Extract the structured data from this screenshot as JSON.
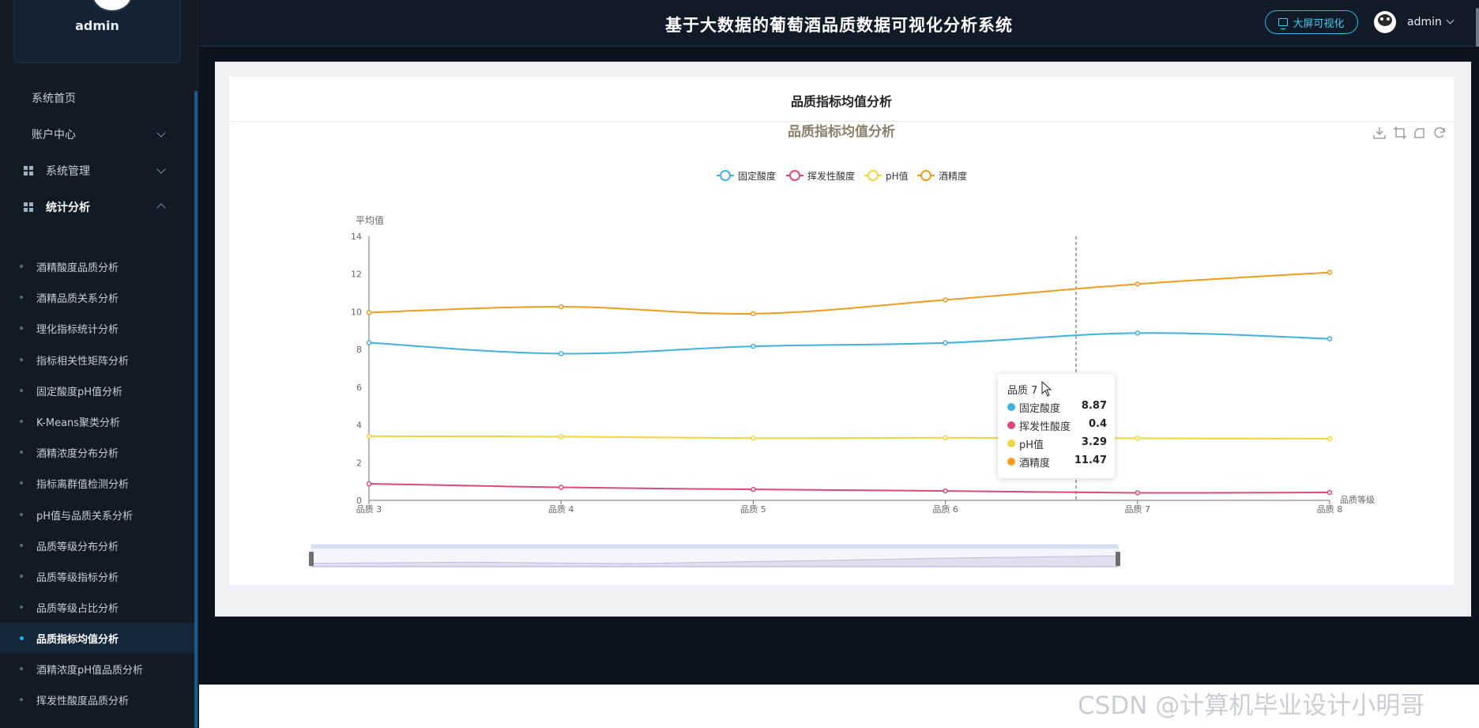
{
  "sidebar": {
    "profile_name": "admin",
    "menu": [
      {
        "label": "系统首页"
      },
      {
        "label": "账户中心"
      },
      {
        "label": "系统管理"
      },
      {
        "label": "统计分析"
      }
    ],
    "submenu": [
      {
        "label": "酒精酸度品质分析"
      },
      {
        "label": "酒精品质关系分析"
      },
      {
        "label": "理化指标统计分析"
      },
      {
        "label": "指标相关性矩阵分析"
      },
      {
        "label": "固定酸度pH值分析"
      },
      {
        "label": "K-Means聚类分析"
      },
      {
        "label": "酒精浓度分布分析"
      },
      {
        "label": "指标离群值检测分析"
      },
      {
        "label": "pH值与品质关系分析"
      },
      {
        "label": "品质等级分布分析"
      },
      {
        "label": "品质等级指标分析"
      },
      {
        "label": "品质等级占比分析"
      },
      {
        "label": "品质指标均值分析"
      },
      {
        "label": "酒精浓度pH值品质分析"
      },
      {
        "label": "挥发性酸度品质分析"
      }
    ],
    "active_submenu": "品质指标均值分析"
  },
  "header": {
    "title": "基于大数据的葡萄酒品质数据可视化分析系统",
    "bigscreen_label": "大屏可视化",
    "username": "admin"
  },
  "card": {
    "title": "品质指标均值分析"
  },
  "icons": {
    "toolbox": [
      "download-icon",
      "zoom-select-icon",
      "zoom-back-icon",
      "restore-icon"
    ]
  },
  "chart_data": {
    "type": "line",
    "title": "品质指标均值分析",
    "ylabel": "平均值",
    "xlabel": "品质等级",
    "categories": [
      "品质 3",
      "品质 4",
      "品质 5",
      "品质 6",
      "品质 7",
      "品质 8"
    ],
    "ylim": [
      0,
      14
    ],
    "yticks": [
      0,
      2,
      4,
      6,
      8,
      10,
      12,
      14
    ],
    "smooth": true,
    "legend_position": "top-center",
    "series": [
      {
        "name": "固定酸度",
        "color": "#3fb1e3",
        "values": [
          8.36,
          7.78,
          8.17,
          8.35,
          8.87,
          8.57
        ]
      },
      {
        "name": "挥发性酸度",
        "color": "#e04878",
        "values": [
          0.88,
          0.69,
          0.58,
          0.5,
          0.4,
          0.42
        ]
      },
      {
        "name": "pH值",
        "color": "#f5d43b",
        "values": [
          3.4,
          3.38,
          3.3,
          3.32,
          3.29,
          3.27
        ]
      },
      {
        "name": "酒精度",
        "color": "#f29b1d",
        "values": [
          9.96,
          10.27,
          9.9,
          10.63,
          11.47,
          12.09
        ]
      }
    ],
    "tooltip": {
      "title": "品质 7",
      "rows": [
        {
          "name": "固定酸度",
          "value": "8.87",
          "color": "#3fb1e3"
        },
        {
          "name": "挥发性酸度",
          "value": "0.4",
          "color": "#e04878"
        },
        {
          "name": "pH值",
          "value": "3.29",
          "color": "#f5d43b"
        },
        {
          "name": "酒精度",
          "value": "11.47",
          "color": "#f29b1d"
        }
      ]
    },
    "crosshair_category": "品质 7",
    "datazoom": {
      "start_percent": 0,
      "end_percent": 100
    }
  },
  "watermark": "CSDN @计算机毕业设计小明哥"
}
